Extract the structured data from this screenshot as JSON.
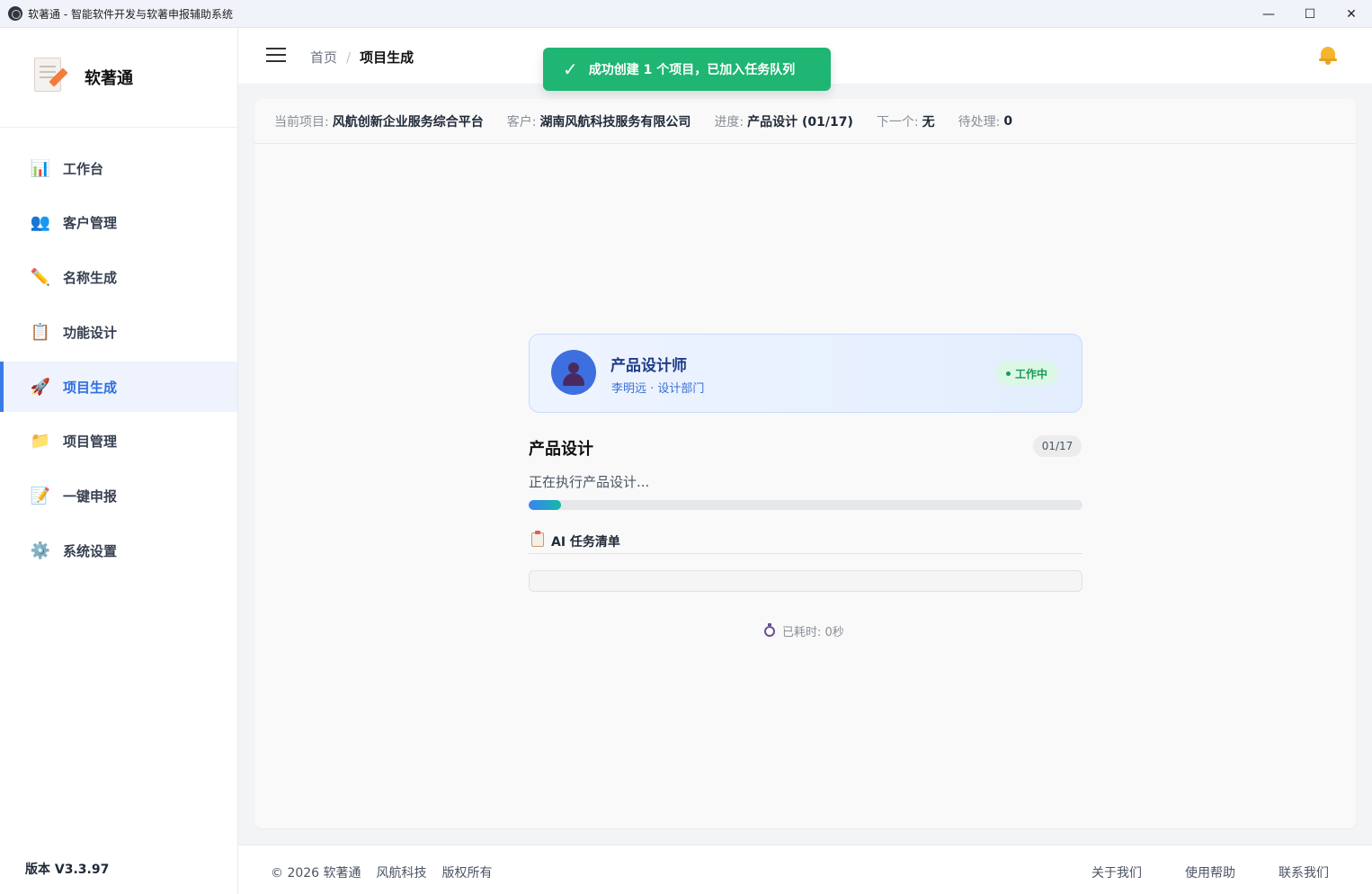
{
  "window": {
    "title": "软著通 - 智能软件开发与软著申报辅助系统",
    "minimize": "—",
    "maximize": "☐",
    "close": "✕"
  },
  "brand": {
    "name": "软著通"
  },
  "sidebar": {
    "items": [
      {
        "label": "工作台",
        "icon": "dashboard-icon",
        "glyph": "📊"
      },
      {
        "label": "客户管理",
        "icon": "users-icon",
        "glyph": "👥"
      },
      {
        "label": "名称生成",
        "icon": "pencil-icon",
        "glyph": "✏️"
      },
      {
        "label": "功能设计",
        "icon": "clipboard-icon",
        "glyph": "📋"
      },
      {
        "label": "项目生成",
        "icon": "rocket-icon",
        "glyph": "🚀",
        "active": true
      },
      {
        "label": "项目管理",
        "icon": "folder-icon",
        "glyph": "📁"
      },
      {
        "label": "一键申报",
        "icon": "document-edit-icon",
        "glyph": "📝"
      },
      {
        "label": "系统设置",
        "icon": "gear-icon",
        "glyph": "⚙️"
      }
    ],
    "version": "版本 V3.3.97"
  },
  "header": {
    "breadcrumb_home": "首页",
    "breadcrumb_sep": "/",
    "breadcrumb_current": "项目生成"
  },
  "toast": {
    "icon": "✓",
    "text": "成功创建 1 个项目，已加入任务队列"
  },
  "info_bar": {
    "project_label": "当前项目:",
    "project_value": "风航创新企业服务综合平台",
    "client_label": "客户:",
    "client_value": "湖南风航科技服务有限公司",
    "progress_label": "进度:",
    "progress_value": "产品设计 (01/17)",
    "next_label": "下一个:",
    "next_value": "无",
    "pending_label": "待处理:",
    "pending_value": "0"
  },
  "worker": {
    "title": "产品设计师",
    "subtitle": "李明远 · 设计部门",
    "status": "工作中"
  },
  "step": {
    "title": "产品设计",
    "count": "01/17",
    "description": "正在执行产品设计...",
    "progress": 0.0588
  },
  "tasks": {
    "title": "AI 任务清单"
  },
  "elapsed": {
    "text": "已耗时: 0秒"
  },
  "footer": {
    "copyright": "© 2026 软著通",
    "company": "风航科技",
    "rights": "版权所有",
    "about": "关于我们",
    "help": "使用帮助",
    "contact": "联系我们"
  },
  "colors": {
    "accent": "#3b7be8",
    "toast": "#1fb573",
    "status_green": "#1a9b56"
  }
}
